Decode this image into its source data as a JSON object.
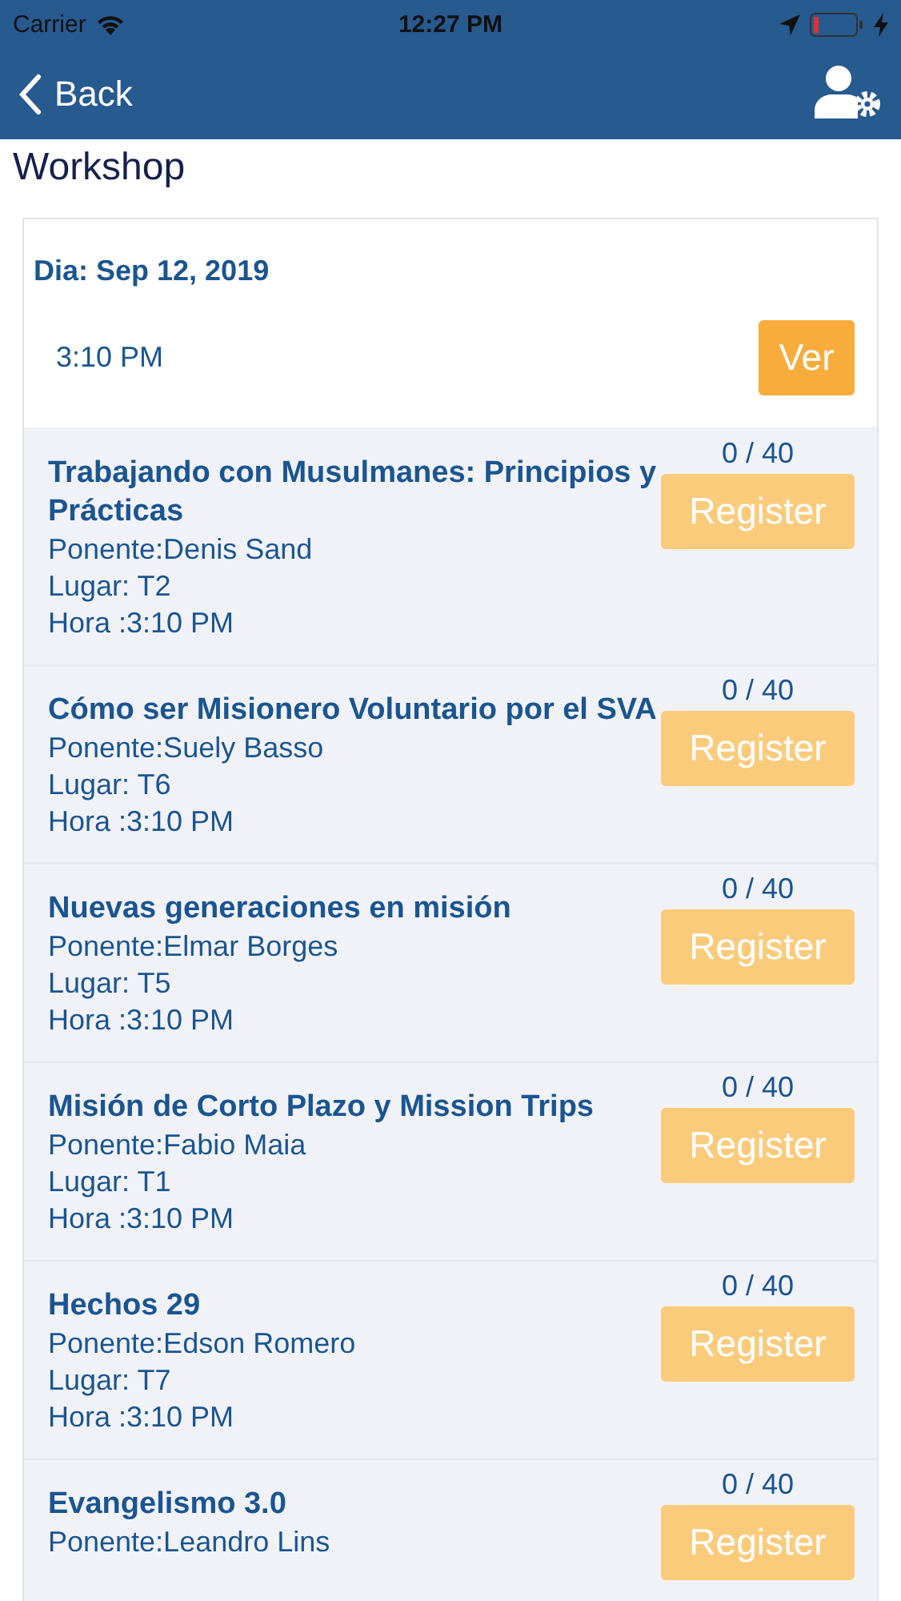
{
  "status_bar": {
    "carrier": "Carrier",
    "time": "12:27 PM"
  },
  "nav": {
    "back": "Back"
  },
  "title": "Workshop",
  "day": {
    "label": "Dia: Sep 12, 2019",
    "time": "3:10 PM",
    "button": "Ver"
  },
  "sessions": [
    {
      "title": "Trabajando con Musulmanes: Principios y Prácticas",
      "lines": [
        "Ponente:Denis Sand",
        "Lugar: T2",
        "Hora :3:10 PM"
      ],
      "count": "0 / 40",
      "button": "Register",
      "disabled": true
    },
    {
      "title": "Cómo ser Misionero Voluntario por el SVA",
      "lines": [
        "Ponente:Suely Basso",
        "Lugar: T6",
        "Hora :3:10 PM"
      ],
      "count": "0 / 40",
      "button": "Register",
      "disabled": true
    },
    {
      "title": "Nuevas generaciones en misión",
      "lines": [
        "Ponente:Elmar Borges",
        "Lugar: T5",
        "Hora :3:10 PM"
      ],
      "count": "0 / 40",
      "button": "Register",
      "disabled": true
    },
    {
      "title": "Misión de Corto Plazo y Mission Trips",
      "lines": [
        "Ponente:Fabio Maia",
        "Lugar: T1",
        "Hora :3:10 PM"
      ],
      "count": "0 / 40",
      "button": "Register",
      "disabled": true
    },
    {
      "title": "Hechos 29",
      "lines": [
        "Ponente:Edson Romero",
        "Lugar: T7",
        "Hora :3:10 PM"
      ],
      "count": "0 / 40",
      "button": "Register",
      "disabled": true
    },
    {
      "title": "Evangelismo 3.0",
      "lines": [
        "Ponente:Leandro Lins"
      ],
      "count": "0 / 40",
      "button": "Register",
      "disabled": true
    }
  ]
}
